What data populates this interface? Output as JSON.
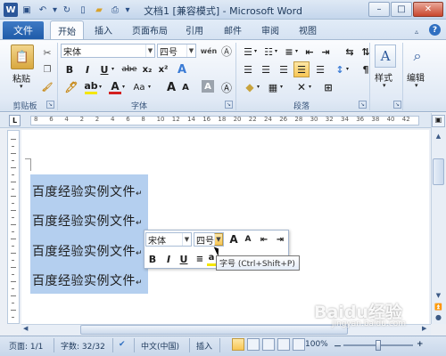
{
  "window": {
    "title": "文档1 [兼容模式] - Microsoft Word",
    "minimize": "–",
    "maximize": "□",
    "close": "✕"
  },
  "tabs": {
    "file": "文件",
    "items": [
      "开始",
      "插入",
      "页面布局",
      "引用",
      "邮件",
      "审阅",
      "视图"
    ],
    "active": "开始"
  },
  "ribbon": {
    "clipboard": {
      "paste": "粘贴",
      "label": "剪贴板"
    },
    "font": {
      "family": "宋体",
      "size": "四号",
      "wen": "wén",
      "bold": "B",
      "italic": "I",
      "underline": "U",
      "strike": "abe",
      "subscript": "x₂",
      "superscript": "x²",
      "grow": "A",
      "shrink": "A",
      "case": "Aa",
      "label": "字体"
    },
    "paragraph": {
      "label": "段落"
    },
    "styles": {
      "label": "样式",
      "icon_letter": "A"
    },
    "editing": {
      "label": "编辑"
    }
  },
  "ruler": {
    "numbers": [
      "8",
      "6",
      "4",
      "2",
      "2",
      "4",
      "6",
      "8",
      "10",
      "12",
      "14",
      "16",
      "18",
      "20",
      "22",
      "24",
      "26",
      "28",
      "30",
      "32",
      "34",
      "36",
      "38",
      "40",
      "42"
    ],
    "corner": "L"
  },
  "document": {
    "lines": [
      "百度经验实例文件",
      "百度经验实例文件",
      "百度经验实例文件",
      "百度经验实例文件"
    ],
    "para_mark": "↵"
  },
  "mini_toolbar": {
    "family": "宋体",
    "size": "四号",
    "grow": "A",
    "shrink": "A",
    "bold": "B",
    "italic": "I",
    "underline": "U"
  },
  "tooltip": "字号 (Ctrl+Shift+P)",
  "statusbar": {
    "page": "页面: 1/1",
    "words": "字数: 32/32",
    "language": "中文(中国)",
    "mode": "插入",
    "zoom": "100%",
    "zoom_out": "－",
    "zoom_in": "+"
  },
  "watermark": {
    "brand": "Baidu经验",
    "url": "jingyan.baidu.com"
  },
  "colors": {
    "accent": "#1f5ba8",
    "selection": "#b4cfef",
    "highlight": "#f8c653"
  }
}
